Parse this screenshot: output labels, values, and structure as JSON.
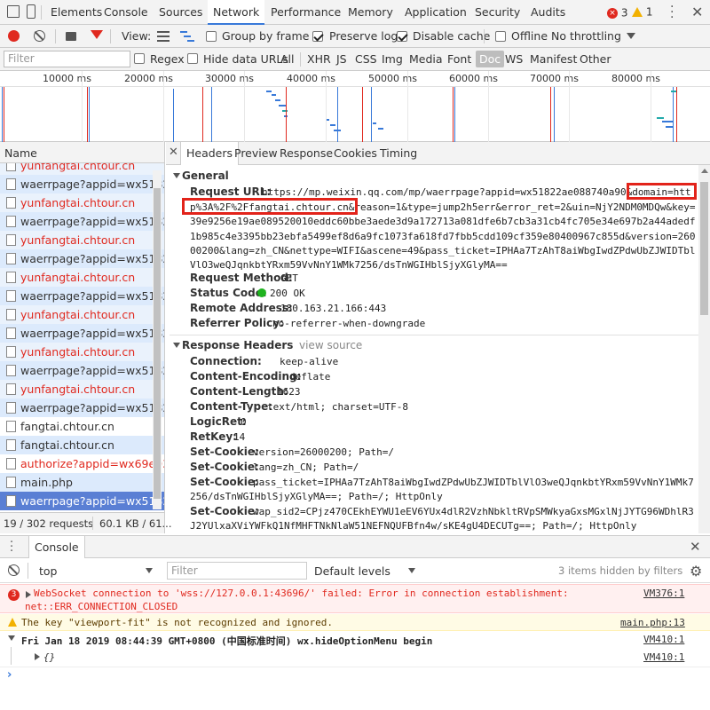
{
  "tabs": [
    "Elements",
    "Console",
    "Sources",
    "Network",
    "Performance",
    "Memory",
    "Application",
    "Security",
    "Audits"
  ],
  "badges": {
    "errors": "3",
    "warnings": "1"
  },
  "toolbar": {
    "view_label": "View:",
    "group_by_frame": "Group by frame",
    "preserve_log": "Preserve log",
    "disable_cache": "Disable cache",
    "offline": "Offline",
    "throttling": "No throttling"
  },
  "filterbar": {
    "placeholder": "Filter",
    "regex": "Regex",
    "hide_data_urls": "Hide data URLs",
    "types": [
      "All",
      "XHR",
      "JS",
      "CSS",
      "Img",
      "Media",
      "Font",
      "Doc",
      "WS",
      "Manifest",
      "Other"
    ],
    "selected_type": "Doc"
  },
  "timeline": {
    "ticks": [
      "10000 ms",
      "20000 ms",
      "30000 ms",
      "40000 ms",
      "50000 ms",
      "60000 ms",
      "70000 ms",
      "80000 ms"
    ]
  },
  "requests": {
    "header": "Name",
    "items": [
      {
        "name": "yunfangtai.chtour.cn",
        "type": "err"
      },
      {
        "name": "waerrpage?appid=wx51822",
        "type": "ok"
      },
      {
        "name": "yunfangtai.chtour.cn",
        "type": "err"
      },
      {
        "name": "waerrpage?appid=wx51822",
        "type": "ok"
      },
      {
        "name": "yunfangtai.chtour.cn",
        "type": "err"
      },
      {
        "name": "waerrpage?appid=wx51822",
        "type": "ok"
      },
      {
        "name": "yunfangtai.chtour.cn",
        "type": "err"
      },
      {
        "name": "waerrpage?appid=wx51822",
        "type": "ok"
      },
      {
        "name": "yunfangtai.chtour.cn",
        "type": "err"
      },
      {
        "name": "waerrpage?appid=wx51822",
        "type": "ok"
      },
      {
        "name": "yunfangtai.chtour.cn",
        "type": "err"
      },
      {
        "name": "waerrpage?appid=wx51822",
        "type": "ok"
      },
      {
        "name": "yunfangtai.chtour.cn",
        "type": "err"
      },
      {
        "name": "waerrpage?appid=wx51822",
        "type": "ok"
      },
      {
        "name": "fangtai.chtour.cn",
        "type": "ok"
      },
      {
        "name": "fangtai.chtour.cn",
        "type": "ok"
      },
      {
        "name": "authorize?appid=wx69e038",
        "type": "err"
      },
      {
        "name": "main.php",
        "type": "ok"
      },
      {
        "name": "waerrpage?appid=wx51822",
        "type": "sel"
      }
    ],
    "status_count": "19 / 302 requests",
    "status_size": "60.1 KB / 61..."
  },
  "detail_tabs": [
    "Headers",
    "Preview",
    "Response",
    "Cookies",
    "Timing"
  ],
  "general": {
    "title": "General",
    "request_url_label": "Request URL:",
    "url_lines": [
      "https://mp.weixin.qq.com/mp/waerrpage?appid=wx51822ae088740a90&domain=htt",
      "p%3A%2F%2Ffangtai.chtour.cn&reason=1&type=jump2h5err&error_ret=2&uin=NjY2NDM0MDQw&key=",
      "39e9256e19ae089520010eddc60bbe3aede3d9a172713a081dfe6b7cb3a31cb4fc705e34e697b2a44adedf",
      "1b985c4e3395bb23ebfa5499ef8d6a9fc1073fa618fd7fbb5cdd109cf359e80400967c855d&version=260",
      "00200&lang=zh_CN&nettype=WIFI&ascene=49&pass_ticket=IPHAa7TzAhT8aiWbgIwdZPdwUbZJWIDTbl",
      "VlO3weQJqnkbtYRxm59VvNnY1WMk7256/dsTnWGIHblSjyXGlyMA=="
    ],
    "method_label": "Request Method:",
    "method": "GET",
    "status_label": "Status Code:",
    "status": "200 OK",
    "remote_label": "Remote Address:",
    "remote": "180.163.21.166:443",
    "referrer_label": "Referrer Policy:",
    "referrer": "no-referrer-when-downgrade"
  },
  "response": {
    "title": "Response Headers",
    "view_source": "view source",
    "headers": [
      {
        "k": "Connection:",
        "v": [
          "keep-alive"
        ]
      },
      {
        "k": "Content-Encoding:",
        "v": [
          "deflate"
        ]
      },
      {
        "k": "Content-Length:",
        "v": [
          "1623"
        ]
      },
      {
        "k": "Content-Type:",
        "v": [
          "text/html; charset=UTF-8"
        ]
      },
      {
        "k": "LogicRet:",
        "v": [
          "0"
        ]
      },
      {
        "k": "RetKey:",
        "v": [
          "14"
        ]
      },
      {
        "k": "Set-Cookie:",
        "v": [
          "version=26000200; Path=/"
        ]
      },
      {
        "k": "Set-Cookie:",
        "v": [
          "lang=zh_CN; Path=/"
        ]
      },
      {
        "k": "Set-Cookie:",
        "v": [
          "pass_ticket=IPHAa7TzAhT8aiWbgIwdZPdwUbZJWIDTblVlO3weQJqnkbtYRxm59VvNnY1WMk7",
          "256/dsTnWGIHblSjyXGlyMA==; Path=/; HttpOnly"
        ]
      },
      {
        "k": "Set-Cookie:",
        "v": [
          "wap_sid2=CPjz470CEkhEYWU1eEV6YUx4dlR2VzhNbkltRVpSMWkyaGxsMGxlNjJYTG96WDhlR3",
          "J2YUlxaXViYWFkQ1NfMHFTNkNlaW51NEFNQUFBfn4w/sKE4gU4DECUTg==; Path=/; HttpOnly"
        ]
      }
    ]
  },
  "console": {
    "tab": "Console",
    "context": "top",
    "filter_placeholder": "Filter",
    "levels": "Default levels",
    "hidden": "3 items hidden by filters",
    "error_count": "3",
    "err_line1": "WebSocket connection to 'wss://127.0.0.1:43696/' failed: Error in connection establishment:",
    "err_line2": "net::ERR_CONNECTION_CLOSED",
    "err_src": "VM376:1",
    "warn_text": "The key \"viewport-fit\" is not recognized and ignored.",
    "warn_src": "main.php:13",
    "log_text": "Fri Jan 18 2019 08:44:39 GMT+0800 (中国标准时间) wx.hideOptionMenu begin",
    "log_src": "VM410:1",
    "obj_text": "{}",
    "obj_src": "VM410:1"
  },
  "colors": {
    "accent": "#3879d9",
    "error": "#e0291f",
    "selected": "#5a7fd4",
    "highlight_box": "#e2231a"
  }
}
